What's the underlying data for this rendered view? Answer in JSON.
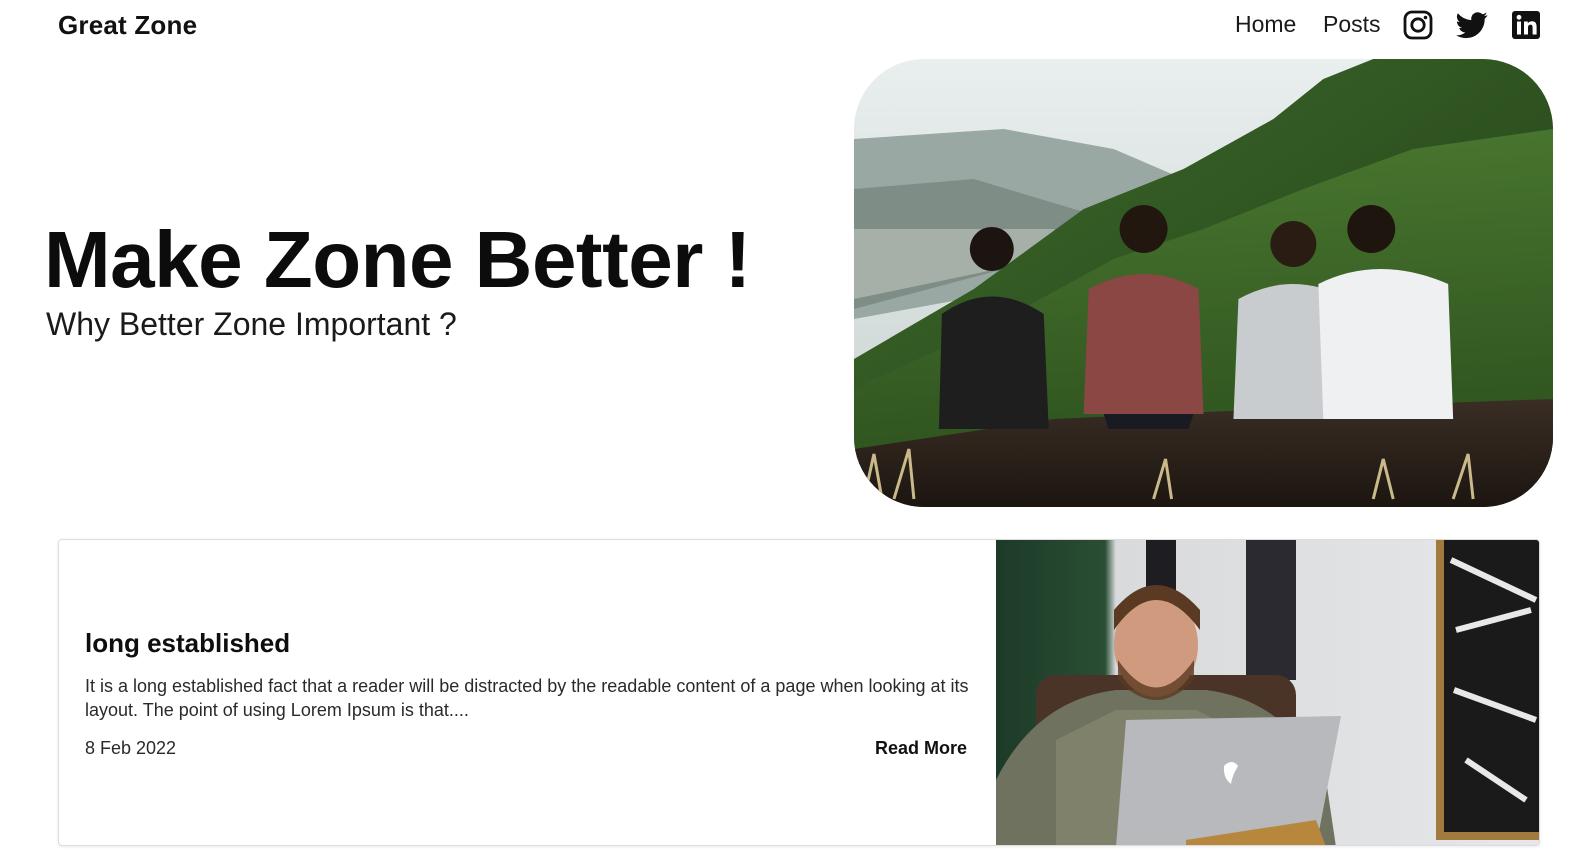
{
  "navbar": {
    "brand": "Great Zone",
    "links": [
      {
        "label": "Home"
      },
      {
        "label": "Posts"
      }
    ],
    "social": [
      {
        "icon": "instagram-icon"
      },
      {
        "icon": "twitter-icon"
      },
      {
        "icon": "linkedin-icon"
      }
    ]
  },
  "hero": {
    "title": "Make Zone Better !",
    "subtitle": "Why Better Zone Important ?"
  },
  "posts": [
    {
      "title": "long established",
      "excerpt": "It is a long established fact that a reader will be distracted by the readable content of a page when looking at its layout. The point of using Lorem Ipsum is that....",
      "date": "8 Feb 2022",
      "read_more": "Read More"
    }
  ],
  "colors": {
    "text": "#111111",
    "card_border": "#dcdcdc",
    "background": "#ffffff"
  }
}
